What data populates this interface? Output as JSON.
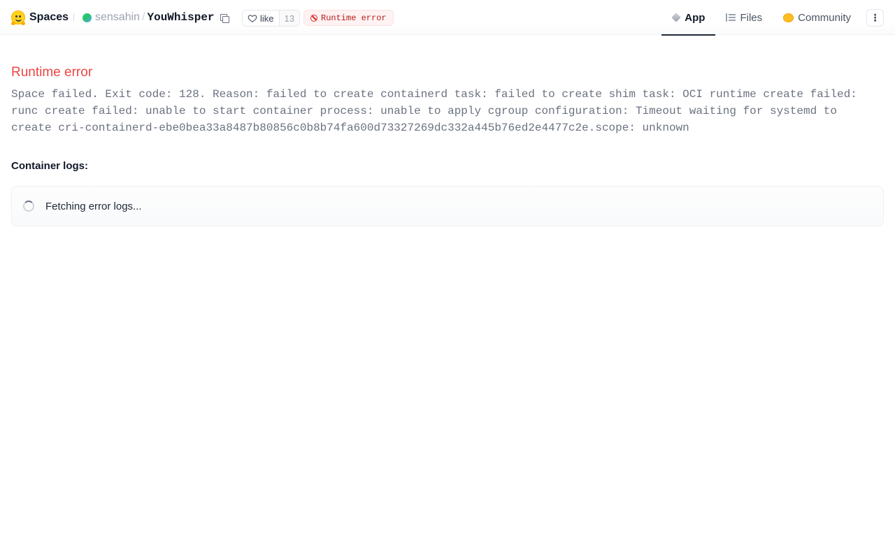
{
  "header": {
    "brand": "Spaces",
    "owner": "sensahin",
    "separator": "/",
    "repo_name": "YouWhisper",
    "like_label": "like",
    "like_count": "13",
    "status": "Runtime error"
  },
  "tabs": [
    {
      "label": "App",
      "icon": "cube-icon",
      "active": true
    },
    {
      "label": "Files",
      "icon": "files-icon",
      "active": false
    },
    {
      "label": "Community",
      "icon": "community-icon",
      "active": false
    }
  ],
  "menu_glyph": "⋮",
  "main": {
    "error_title": "Runtime error",
    "error_message": "Space failed. Exit code: 128. Reason: failed to create containerd task: failed to create shim task: OCI runtime create failed:\nrunc create failed: unable to start container process: unable to apply cgroup configuration: Timeout waiting for systemd to\ncreate cri-containerd-ebe0bea33a8487b80856c0b8b74fa600d73327269dc332a445b76ed2e4477c2e.scope: unknown",
    "logs_label": "Container logs:",
    "logs_status": "Fetching error logs..."
  },
  "colors": {
    "error": "#ef4444",
    "status_badge_bg": "#fef2f2",
    "status_badge_text": "#b91c1c"
  }
}
